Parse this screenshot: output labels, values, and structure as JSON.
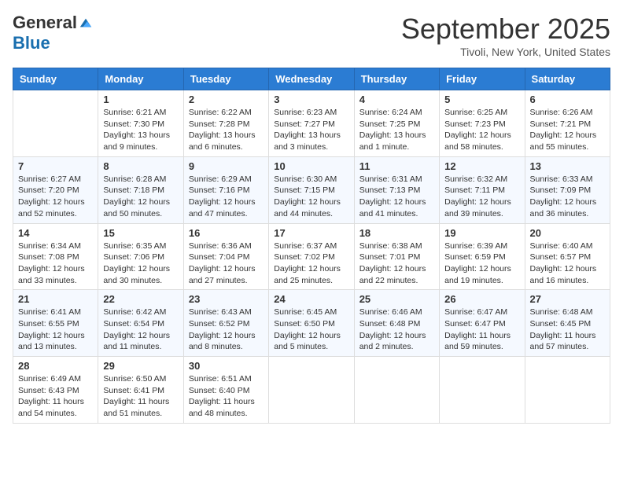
{
  "header": {
    "logo_general": "General",
    "logo_blue": "Blue",
    "month_title": "September 2025",
    "location": "Tivoli, New York, United States"
  },
  "days_of_week": [
    "Sunday",
    "Monday",
    "Tuesday",
    "Wednesday",
    "Thursday",
    "Friday",
    "Saturday"
  ],
  "weeks": [
    [
      {
        "day": "",
        "sunrise": "",
        "sunset": "",
        "daylight": ""
      },
      {
        "day": "1",
        "sunrise": "Sunrise: 6:21 AM",
        "sunset": "Sunset: 7:30 PM",
        "daylight": "Daylight: 13 hours and 9 minutes."
      },
      {
        "day": "2",
        "sunrise": "Sunrise: 6:22 AM",
        "sunset": "Sunset: 7:28 PM",
        "daylight": "Daylight: 13 hours and 6 minutes."
      },
      {
        "day": "3",
        "sunrise": "Sunrise: 6:23 AM",
        "sunset": "Sunset: 7:27 PM",
        "daylight": "Daylight: 13 hours and 3 minutes."
      },
      {
        "day": "4",
        "sunrise": "Sunrise: 6:24 AM",
        "sunset": "Sunset: 7:25 PM",
        "daylight": "Daylight: 13 hours and 1 minute."
      },
      {
        "day": "5",
        "sunrise": "Sunrise: 6:25 AM",
        "sunset": "Sunset: 7:23 PM",
        "daylight": "Daylight: 12 hours and 58 minutes."
      },
      {
        "day": "6",
        "sunrise": "Sunrise: 6:26 AM",
        "sunset": "Sunset: 7:21 PM",
        "daylight": "Daylight: 12 hours and 55 minutes."
      }
    ],
    [
      {
        "day": "7",
        "sunrise": "Sunrise: 6:27 AM",
        "sunset": "Sunset: 7:20 PM",
        "daylight": "Daylight: 12 hours and 52 minutes."
      },
      {
        "day": "8",
        "sunrise": "Sunrise: 6:28 AM",
        "sunset": "Sunset: 7:18 PM",
        "daylight": "Daylight: 12 hours and 50 minutes."
      },
      {
        "day": "9",
        "sunrise": "Sunrise: 6:29 AM",
        "sunset": "Sunset: 7:16 PM",
        "daylight": "Daylight: 12 hours and 47 minutes."
      },
      {
        "day": "10",
        "sunrise": "Sunrise: 6:30 AM",
        "sunset": "Sunset: 7:15 PM",
        "daylight": "Daylight: 12 hours and 44 minutes."
      },
      {
        "day": "11",
        "sunrise": "Sunrise: 6:31 AM",
        "sunset": "Sunset: 7:13 PM",
        "daylight": "Daylight: 12 hours and 41 minutes."
      },
      {
        "day": "12",
        "sunrise": "Sunrise: 6:32 AM",
        "sunset": "Sunset: 7:11 PM",
        "daylight": "Daylight: 12 hours and 39 minutes."
      },
      {
        "day": "13",
        "sunrise": "Sunrise: 6:33 AM",
        "sunset": "Sunset: 7:09 PM",
        "daylight": "Daylight: 12 hours and 36 minutes."
      }
    ],
    [
      {
        "day": "14",
        "sunrise": "Sunrise: 6:34 AM",
        "sunset": "Sunset: 7:08 PM",
        "daylight": "Daylight: 12 hours and 33 minutes."
      },
      {
        "day": "15",
        "sunrise": "Sunrise: 6:35 AM",
        "sunset": "Sunset: 7:06 PM",
        "daylight": "Daylight: 12 hours and 30 minutes."
      },
      {
        "day": "16",
        "sunrise": "Sunrise: 6:36 AM",
        "sunset": "Sunset: 7:04 PM",
        "daylight": "Daylight: 12 hours and 27 minutes."
      },
      {
        "day": "17",
        "sunrise": "Sunrise: 6:37 AM",
        "sunset": "Sunset: 7:02 PM",
        "daylight": "Daylight: 12 hours and 25 minutes."
      },
      {
        "day": "18",
        "sunrise": "Sunrise: 6:38 AM",
        "sunset": "Sunset: 7:01 PM",
        "daylight": "Daylight: 12 hours and 22 minutes."
      },
      {
        "day": "19",
        "sunrise": "Sunrise: 6:39 AM",
        "sunset": "Sunset: 6:59 PM",
        "daylight": "Daylight: 12 hours and 19 minutes."
      },
      {
        "day": "20",
        "sunrise": "Sunrise: 6:40 AM",
        "sunset": "Sunset: 6:57 PM",
        "daylight": "Daylight: 12 hours and 16 minutes."
      }
    ],
    [
      {
        "day": "21",
        "sunrise": "Sunrise: 6:41 AM",
        "sunset": "Sunset: 6:55 PM",
        "daylight": "Daylight: 12 hours and 13 minutes."
      },
      {
        "day": "22",
        "sunrise": "Sunrise: 6:42 AM",
        "sunset": "Sunset: 6:54 PM",
        "daylight": "Daylight: 12 hours and 11 minutes."
      },
      {
        "day": "23",
        "sunrise": "Sunrise: 6:43 AM",
        "sunset": "Sunset: 6:52 PM",
        "daylight": "Daylight: 12 hours and 8 minutes."
      },
      {
        "day": "24",
        "sunrise": "Sunrise: 6:45 AM",
        "sunset": "Sunset: 6:50 PM",
        "daylight": "Daylight: 12 hours and 5 minutes."
      },
      {
        "day": "25",
        "sunrise": "Sunrise: 6:46 AM",
        "sunset": "Sunset: 6:48 PM",
        "daylight": "Daylight: 12 hours and 2 minutes."
      },
      {
        "day": "26",
        "sunrise": "Sunrise: 6:47 AM",
        "sunset": "Sunset: 6:47 PM",
        "daylight": "Daylight: 11 hours and 59 minutes."
      },
      {
        "day": "27",
        "sunrise": "Sunrise: 6:48 AM",
        "sunset": "Sunset: 6:45 PM",
        "daylight": "Daylight: 11 hours and 57 minutes."
      }
    ],
    [
      {
        "day": "28",
        "sunrise": "Sunrise: 6:49 AM",
        "sunset": "Sunset: 6:43 PM",
        "daylight": "Daylight: 11 hours and 54 minutes."
      },
      {
        "day": "29",
        "sunrise": "Sunrise: 6:50 AM",
        "sunset": "Sunset: 6:41 PM",
        "daylight": "Daylight: 11 hours and 51 minutes."
      },
      {
        "day": "30",
        "sunrise": "Sunrise: 6:51 AM",
        "sunset": "Sunset: 6:40 PM",
        "daylight": "Daylight: 11 hours and 48 minutes."
      },
      {
        "day": "",
        "sunrise": "",
        "sunset": "",
        "daylight": ""
      },
      {
        "day": "",
        "sunrise": "",
        "sunset": "",
        "daylight": ""
      },
      {
        "day": "",
        "sunrise": "",
        "sunset": "",
        "daylight": ""
      },
      {
        "day": "",
        "sunrise": "",
        "sunset": "",
        "daylight": ""
      }
    ]
  ]
}
